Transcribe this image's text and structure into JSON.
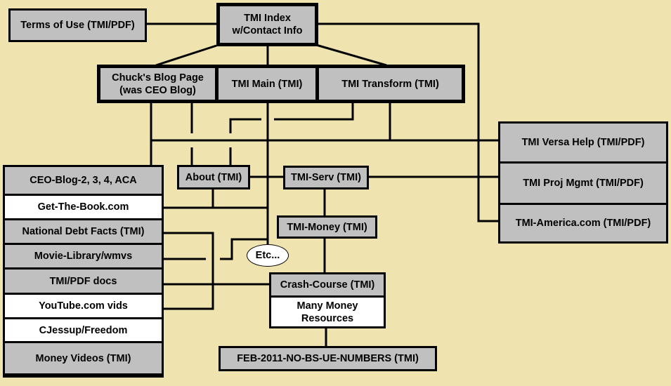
{
  "diagram": {
    "background_color": "#efe3b0",
    "box_color": "#c0c0c0",
    "highlight_box_color": "#ffffff",
    "nodes": {
      "terms_of_use": "Terms of Use (TMI/PDF)",
      "tmi_index_line1": "TMI Index",
      "tmi_index_line2": "w/Contact Info",
      "chucks_blog_line1": "Chuck's Blog Page",
      "chucks_blog_line2": "(was CEO Blog)",
      "tmi_main": "TMI Main (TMI)",
      "tmi_transform": "TMI Transform (TMI)",
      "about": "About (TMI)",
      "tmi_serv": "TMI-Serv (TMI)",
      "tmi_money": "TMI-Money (TMI)",
      "etc": "Etc...",
      "crash_course": "Crash-Course (TMI)",
      "many_money_line1": "Many Money",
      "many_money_line2": "Resources",
      "feb_2011": "FEB-2011-NO-BS-UE-NUMBERS (TMI)"
    },
    "left_stack": [
      {
        "label": "CEO-Blog-2, 3, 4, ACA",
        "highlight": false
      },
      {
        "label": "Get-The-Book.com",
        "highlight": true
      },
      {
        "label": "National Debt Facts (TMI)",
        "highlight": false
      },
      {
        "label": "Movie-Library/wmvs",
        "highlight": false
      },
      {
        "label": "TMI/PDF docs",
        "highlight": false
      },
      {
        "label": "YouTube.com vids",
        "highlight": true
      },
      {
        "label": "CJessup/Freedom",
        "highlight": true
      },
      {
        "label": "Money Videos (TMI)",
        "highlight": false
      }
    ],
    "right_stack": [
      {
        "label": "TMI Versa Help (TMI/PDF)"
      },
      {
        "label": "TMI Proj Mgmt (TMI/PDF)"
      },
      {
        "label": "TMI-America.com (TMI/PDF)"
      }
    ]
  }
}
